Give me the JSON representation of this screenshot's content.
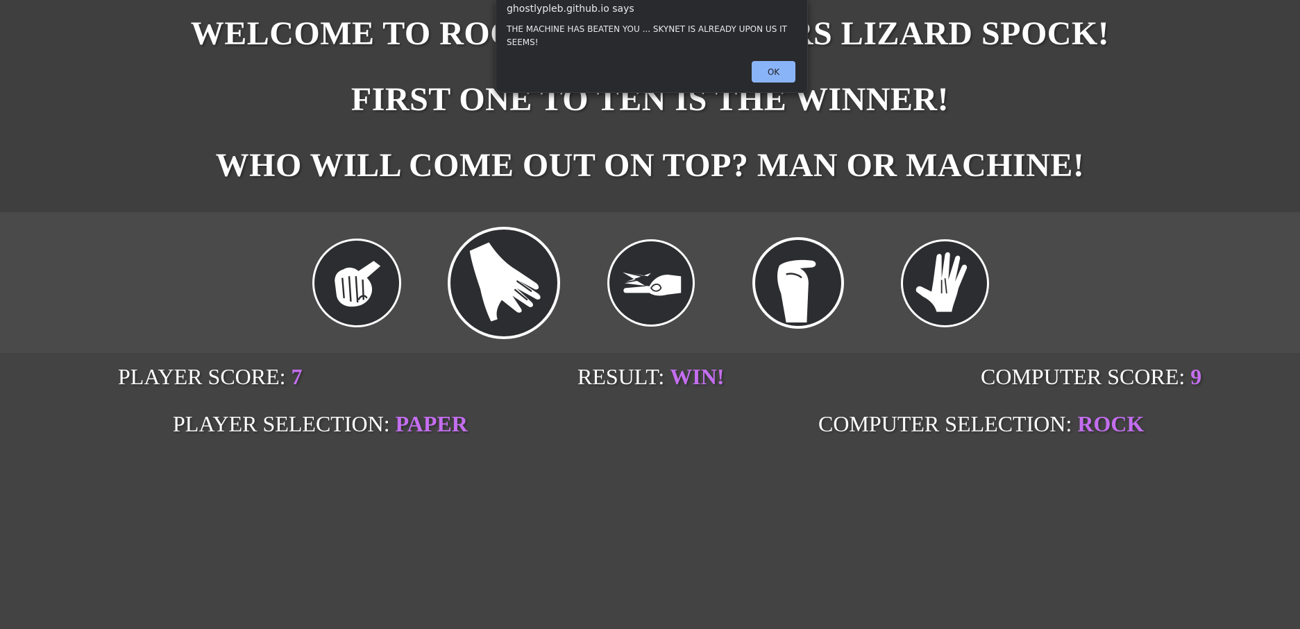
{
  "headings": {
    "welcome": "WELCOME TO ROCK PAPER SCISSORS LIZARD SPOCK!",
    "rule": "FIRST ONE TO TEN IS THE WINNER!",
    "question": "WHO WILL COME OUT ON TOP? MAN OR MACHINE!"
  },
  "choices": [
    {
      "name": "rock",
      "icon": "rock-fist-icon"
    },
    {
      "name": "paper",
      "icon": "paper-hand-icon"
    },
    {
      "name": "scissors",
      "icon": "scissors-hand-icon"
    },
    {
      "name": "lizard",
      "icon": "lizard-hand-icon"
    },
    {
      "name": "spock",
      "icon": "spock-hand-icon"
    }
  ],
  "scoreboard": {
    "player_score_label": "PLAYER SCORE: ",
    "player_score": "7",
    "result_label": "RESULT: ",
    "result": "WIN!",
    "computer_score_label": "COMPUTER SCORE: ",
    "computer_score": "9",
    "player_selection_label": "PLAYER SELECTION: ",
    "player_selection": "PAPER",
    "computer_selection_label": "COMPUTER SELECTION: ",
    "computer_selection": "ROCK"
  },
  "alert": {
    "origin": "ghostlypleb.github.io says",
    "message": "THE MACHINE HAS BEATEN YOU ... SKYNET IS ALREADY UPON US IT SEEMS!",
    "ok_label": "OK"
  },
  "colors": {
    "background": "#434343",
    "choice_strip": "#4a4a4a",
    "value_accent": "#c46ef0",
    "dialog_background": "#292a2d",
    "ok_button": "#8ab4f8"
  }
}
